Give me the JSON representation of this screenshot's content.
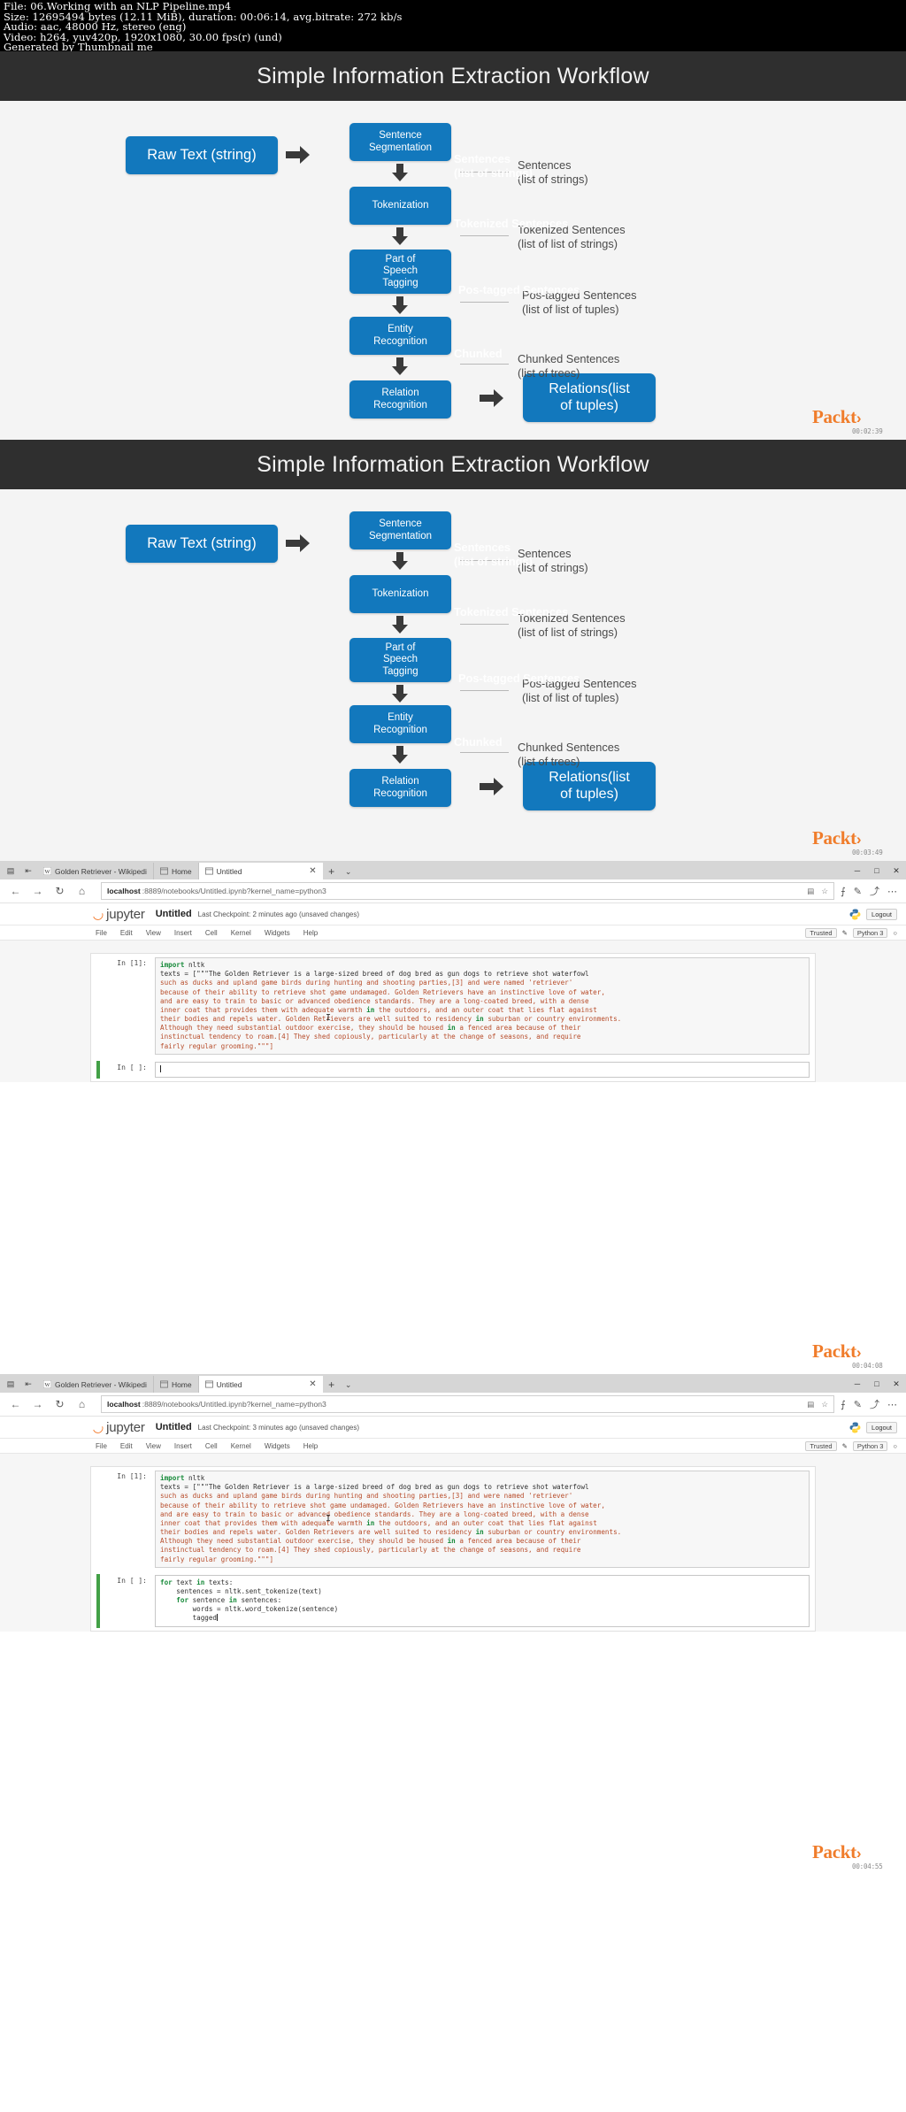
{
  "fileinfo": {
    "line1": "File: 06.Working with an NLP Pipeline.mp4",
    "line2": "Size: 12695494 bytes (12.11 MiB), duration: 00:06:14, avg.bitrate: 272 kb/s",
    "line3": "Audio: aac, 48000 Hz, stereo (eng)",
    "line4": "Video: h264, yuv420p, 1920x1080, 30.00 fps(r) (und)",
    "line5": "Generated by Thumbnail me"
  },
  "slide": {
    "title": "Simple Information Extraction Workflow",
    "nodes": {
      "raw_text": "Raw Text (string)",
      "sentence_segmentation": "Sentence\nSegmentation",
      "tokenization": "Tokenization",
      "pos_tagging": "Part of\nSpeech\nTagging",
      "entity_recognition": "Entity\nRecognition",
      "relation_recognition": "Relation\nRecognition",
      "relations_output": "Relations(list\nof tuples)"
    },
    "annotations": [
      {
        "label": "Sentences",
        "detail": "(list of strings)"
      },
      {
        "label": "Tokenized Sentences",
        "detail": "(list of list of strings)"
      },
      {
        "label": "Pos-tagged Sentences",
        "detail": "(list of list of tuples)"
      },
      {
        "label": "Chunked Sentences",
        "detail": "(list of trees)"
      }
    ],
    "ghost_text": [
      "Sentences",
      "(list of strings)",
      "Tokenized Sentences",
      "Pos-tagged Sentences",
      "Chunked"
    ],
    "brand": "Packt",
    "brand_mark": "›",
    "accent_blue": "#1278bd",
    "header_bg": "#2f2f2f",
    "brand_color": "#f07c2a"
  },
  "frames": [
    {
      "timestamp": "00:02:39"
    },
    {
      "timestamp": "00:03:49"
    },
    {
      "timestamp": "00:04:08"
    },
    {
      "timestamp": "00:04:55"
    }
  ],
  "browser": {
    "tabs": [
      {
        "label": "Golden Retriever - Wikipedi",
        "favicon": "wikipedia-icon",
        "active": false
      },
      {
        "label": "Home",
        "favicon": "window-icon",
        "active": false
      },
      {
        "label": "Untitled",
        "favicon": "window-icon",
        "active": true
      }
    ],
    "newtab_label": "+",
    "tabmenu_label": "⌄",
    "window_controls": {
      "minimize": "─",
      "maximize": "□",
      "close": "✕"
    },
    "nav": {
      "back": "←",
      "forward": "→",
      "reload": "↻",
      "home": "⌂"
    },
    "url": {
      "host": "localhost",
      "path": ":8889/notebooks/Untitled.ipynb?kernel_name=python3"
    },
    "url_icons": {
      "reading_view": "▤",
      "favorite": "☆"
    },
    "toolbar_right": {
      "notes": "⨍",
      "pen": "✎",
      "share": "⤴",
      "more": "⋯"
    }
  },
  "jupyter": {
    "logo_word": "jupyter",
    "notebook_title": "Untitled",
    "menu_items": [
      "File",
      "Edit",
      "View",
      "Insert",
      "Cell",
      "Kernel",
      "Widgets",
      "Help"
    ],
    "trusted_label": "Trusted",
    "kernel_label": "Python 3",
    "logout_label": "Logout",
    "kernel_idle": "○"
  },
  "notebooks": [
    {
      "checkpoint": "Last Checkpoint: 2 minutes ago (unsaved changes)",
      "cells": [
        {
          "prompt": "In [1]:",
          "selected": false,
          "active": false,
          "lines": [
            "import nltk",
            "texts = [\"\"\"The Golden Retriever is a large-sized breed of dog bred as gun dogs to retrieve shot waterfowl",
            "such as ducks and upland game birds during hunting and shooting parties,[3] and were named 'retriever'",
            "because of their ability to retrieve shot game undamaged. Golden Retrievers have an instinctive love of water,",
            "and are easy to train to basic or advanced obedience standards. They are a long-coated breed, with a dense",
            "inner coat that provides them with adequate warmth in the outdoors, and an outer coat that lies flat against",
            "their bodies and repels water. Golden Retrievers are well suited to residency in suburban or country environments.",
            "Although they need substantial outdoor exercise, they should be housed in a fenced area because of their",
            "instinctual tendency to roam.[4] They shed copiously, particularly at the change of seasons, and require",
            "fairly regular grooming.\"\"\"]"
          ]
        },
        {
          "prompt": "In [ ]:",
          "selected": true,
          "active": true,
          "lines": [
            ""
          ]
        }
      ]
    },
    {
      "checkpoint": "Last Checkpoint: 3 minutes ago (unsaved changes)",
      "cells": [
        {
          "prompt": "In [1]:",
          "selected": false,
          "active": false,
          "lines": [
            "import nltk",
            "texts = [\"\"\"The Golden Retriever is a large-sized breed of dog bred as gun dogs to retrieve shot waterfowl",
            "such as ducks and upland game birds during hunting and shooting parties,[3] and were named 'retriever'",
            "because of their ability to retrieve shot game undamaged. Golden Retrievers have an instinctive love of water,",
            "and are easy to train to basic or advanced obedience standards. They are a long-coated breed, with a dense",
            "inner coat that provides them with adequate warmth in the outdoors, and an outer coat that lies flat against",
            "their bodies and repels water. Golden Retrievers are well suited to residency in suburban or country environments.",
            "Although they need substantial outdoor exercise, they should be housed in a fenced area because of their",
            "instinctual tendency to roam.[4] They shed copiously, particularly at the change of seasons, and require",
            "fairly regular grooming.\"\"\"]"
          ]
        },
        {
          "prompt": "In [ ]:",
          "selected": true,
          "active": true,
          "lines": [
            "for text in texts:",
            "    sentences = nltk.sent_tokenize(text)",
            "    for sentence in sentences:",
            "        words = nltk.word_tokenize(sentence)",
            "        tagged"
          ]
        }
      ]
    }
  ]
}
